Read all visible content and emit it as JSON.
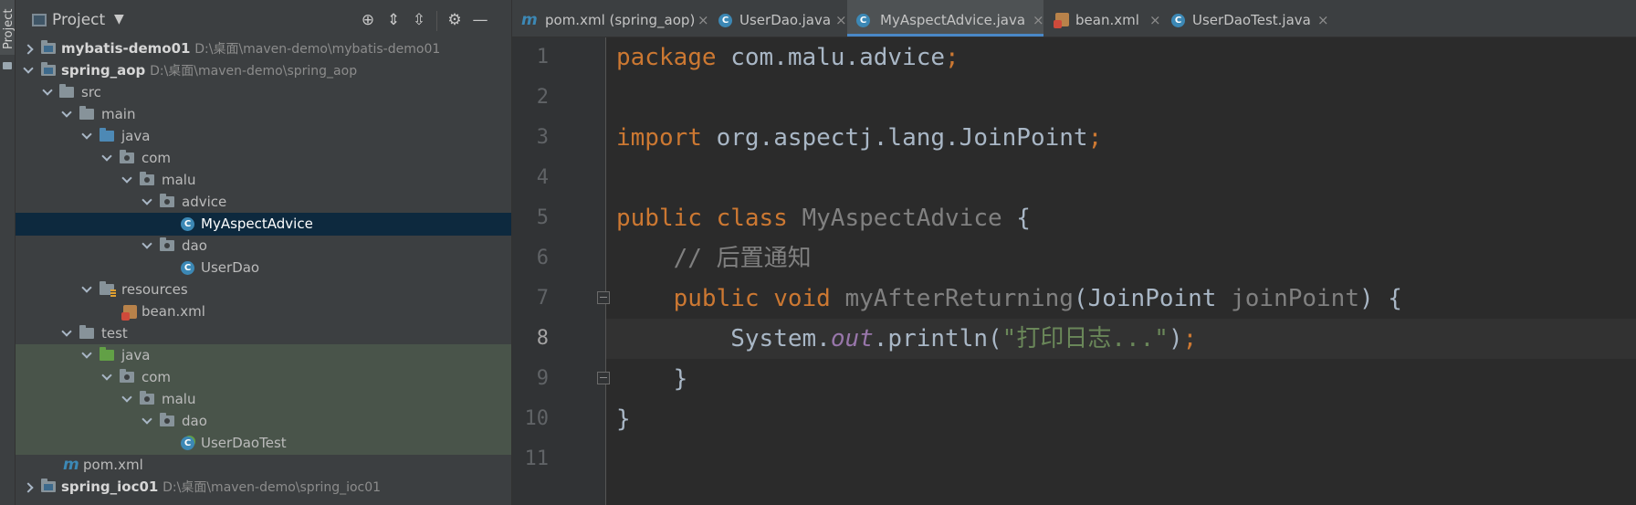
{
  "sidebar_strip": {
    "label": "Project"
  },
  "project_panel": {
    "title": "Project",
    "tree": [
      {
        "label": "mybatis-demo01",
        "path": "D:\\桌面\\maven-demo\\mybatis-demo01"
      },
      {
        "label": "spring_aop",
        "path": "D:\\桌面\\maven-demo\\spring_aop"
      },
      {
        "label": "src"
      },
      {
        "label": "main"
      },
      {
        "label": "java"
      },
      {
        "label": "com"
      },
      {
        "label": "malu"
      },
      {
        "label": "advice"
      },
      {
        "label": "MyAspectAdvice"
      },
      {
        "label": "dao"
      },
      {
        "label": "UserDao"
      },
      {
        "label": "resources"
      },
      {
        "label": "bean.xml"
      },
      {
        "label": "test"
      },
      {
        "label": "java"
      },
      {
        "label": "com"
      },
      {
        "label": "malu"
      },
      {
        "label": "dao"
      },
      {
        "label": "UserDaoTest"
      },
      {
        "label": "pom.xml"
      },
      {
        "label": "spring_ioc01",
        "path": "D:\\桌面\\maven-demo\\spring_ioc01"
      }
    ]
  },
  "tabs": [
    {
      "label": "pom.xml (spring_aop)"
    },
    {
      "label": "UserDao.java"
    },
    {
      "label": "MyAspectAdvice.java"
    },
    {
      "label": "bean.xml"
    },
    {
      "label": "UserDaoTest.java"
    }
  ],
  "editor": {
    "line_numbers": [
      "1",
      "2",
      "3",
      "4",
      "5",
      "6",
      "7",
      "8",
      "9",
      "10",
      "11"
    ],
    "current_line": 8,
    "lines": {
      "l1": {
        "kw": "package",
        "rest": " com.malu.advice",
        "semi": ";"
      },
      "l3": {
        "kw": "import",
        "rest": " org.aspectj.lang.JoinPoint",
        "semi": ";"
      },
      "l5": {
        "kw": "public class",
        "name": "MyAspectAdvice",
        "rest": " {"
      },
      "l6": {
        "comment": "// 后置通知"
      },
      "l7": {
        "kw": "public void",
        "name": "myAfterReturning",
        "open": "(JoinPoint ",
        "param": "joinPoint",
        "close": ") {"
      },
      "l8": {
        "pre": "System.",
        "field": "out",
        "mid": ".println(",
        "str": "\"打印日志...\"",
        "post": ")",
        "semi": ";"
      },
      "l9": {
        "text": "}"
      },
      "l10": {
        "text": "}"
      }
    }
  }
}
